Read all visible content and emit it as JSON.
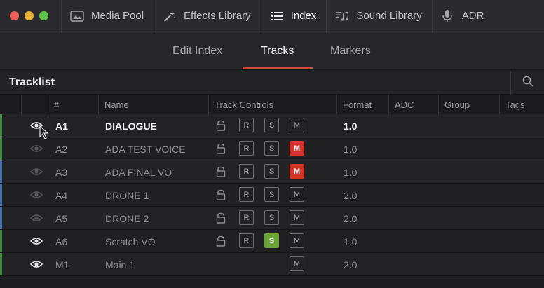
{
  "toolbar": {
    "traffic_colors": [
      "#ec5f57",
      "#e6b13a",
      "#5fc54a"
    ],
    "items": [
      {
        "label": "Media Pool",
        "icon": "media-pool-icon"
      },
      {
        "label": "Effects Library",
        "icon": "magic-wand-icon"
      },
      {
        "label": "Index",
        "icon": "list-icon",
        "active": true
      },
      {
        "label": "Sound Library",
        "icon": "sound-library-icon"
      },
      {
        "label": "ADR",
        "icon": "microphone-icon"
      }
    ]
  },
  "subtabs": [
    "Edit Index",
    "Tracks",
    "Markers"
  ],
  "active_subtab": "Tracks",
  "tracklist": {
    "title": "Tracklist",
    "columns": [
      "#",
      "Name",
      "Track Controls",
      "Format",
      "ADC",
      "Group",
      "Tags"
    ],
    "rows": [
      {
        "num": "A1",
        "name": "DIALOGUE",
        "visible": true,
        "bright": true,
        "mute": false,
        "solo": false,
        "format": "1.0",
        "bar": "#3f8a3f"
      },
      {
        "num": "A2",
        "name": "ADA TEST VOICE",
        "visible": false,
        "bright": false,
        "mute": true,
        "solo": false,
        "format": "1.0",
        "bar": "#3f8a3f"
      },
      {
        "num": "A3",
        "name": "ADA FINAL VO",
        "visible": false,
        "bright": false,
        "mute": true,
        "solo": false,
        "format": "1.0",
        "bar": "#4a6fae"
      },
      {
        "num": "A4",
        "name": "DRONE 1",
        "visible": false,
        "bright": false,
        "mute": false,
        "solo": false,
        "format": "2.0",
        "bar": "#4a6fae"
      },
      {
        "num": "A5",
        "name": "DRONE 2",
        "visible": false,
        "bright": false,
        "mute": false,
        "solo": false,
        "format": "2.0",
        "bar": "#4a6fae"
      },
      {
        "num": "A6",
        "name": "Scratch VO",
        "visible": true,
        "bright": false,
        "mute": false,
        "solo": true,
        "format": "1.0",
        "bar": "#3f8a3f"
      },
      {
        "num": "M1",
        "name": "Main 1",
        "visible": true,
        "bright": false,
        "mute": false,
        "solo": false,
        "format": "2.0",
        "bar": "#3f8a3f",
        "master": true
      }
    ],
    "button_labels": {
      "record": "R",
      "solo": "S",
      "mute": "M"
    }
  }
}
